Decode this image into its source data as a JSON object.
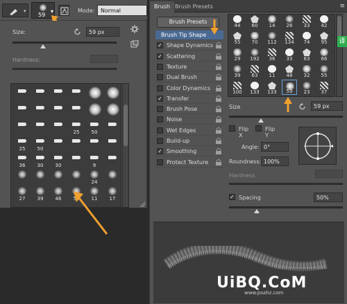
{
  "options_bar": {
    "brush_size": "59",
    "mode_label": "Mode:",
    "mode_value": "Normal"
  },
  "brush_picker": {
    "size_label": "Size:",
    "size_value": "59 px",
    "hardness_label": "Hardness:",
    "grid": [
      {
        "n": ""
      },
      {
        "n": ""
      },
      {
        "n": ""
      },
      {
        "n": ""
      },
      {
        "n": ""
      },
      {
        "n": ""
      },
      {
        "n": ""
      },
      {
        "n": ""
      },
      {
        "n": ""
      },
      {
        "n": ""
      },
      {
        "n": ""
      },
      {
        "n": ""
      },
      {
        "n": ""
      },
      {
        "n": ""
      },
      {
        "n": ""
      },
      {
        "n": "25"
      },
      {
        "n": "50"
      },
      {
        "n": ""
      },
      {
        "n": "25"
      },
      {
        "n": "50"
      },
      {
        "n": ""
      },
      {
        "n": ""
      },
      {
        "n": ""
      },
      {
        "n": ""
      },
      {
        "n": "36"
      },
      {
        "n": "30"
      },
      {
        "n": "30"
      },
      {
        "n": ""
      },
      {
        "n": "9"
      },
      {
        "n": ""
      },
      {
        "n": ""
      },
      {
        "n": ""
      },
      {
        "n": ""
      },
      {
        "n": ""
      },
      {
        "n": "24"
      },
      {
        "n": ""
      },
      {
        "n": "27"
      },
      {
        "n": "39"
      },
      {
        "n": "46"
      },
      {
        "n": "59"
      },
      {
        "n": "11"
      },
      {
        "n": "17"
      }
    ]
  },
  "brush_panel": {
    "tabs": [
      {
        "label": "Brush"
      },
      {
        "label": "Brush Presets"
      }
    ],
    "presets_button": "Brush Presets",
    "options": [
      {
        "label": "Brush Tip Shape",
        "checked": null
      },
      {
        "label": "Shape Dynamics",
        "checked": true
      },
      {
        "label": "Scattering",
        "checked": true
      },
      {
        "label": "Texture",
        "checked": false
      },
      {
        "label": "Dual Brush",
        "checked": false
      },
      {
        "label": "Color Dynamics",
        "checked": false
      },
      {
        "label": "Transfer",
        "checked": true
      },
      {
        "label": "Brush Pose",
        "checked": false
      },
      {
        "label": "Noise",
        "checked": false
      },
      {
        "label": "Wet Edges",
        "checked": false
      },
      {
        "label": "Build-up",
        "checked": false
      },
      {
        "label": "Smoothing",
        "checked": true
      },
      {
        "label": "Protect Texture",
        "checked": false
      }
    ],
    "tip_grid": [
      {
        "n": "44"
      },
      {
        "n": "60"
      },
      {
        "n": "14"
      },
      {
        "n": "26"
      },
      {
        "n": "33"
      },
      {
        "n": "42"
      },
      {
        "n": "55"
      },
      {
        "n": "70"
      },
      {
        "n": "112"
      },
      {
        "n": "134"
      },
      {
        "n": "74"
      },
      {
        "n": "95"
      },
      {
        "n": "29"
      },
      {
        "n": "192"
      },
      {
        "n": "36"
      },
      {
        "n": "33"
      },
      {
        "n": "63"
      },
      {
        "n": "66"
      },
      {
        "n": "39"
      },
      {
        "n": "63"
      },
      {
        "n": "11"
      },
      {
        "n": "48"
      },
      {
        "n": "32"
      },
      {
        "n": "55"
      },
      {
        "n": "100"
      },
      {
        "n": "133"
      },
      {
        "n": "133"
      },
      {
        "n": "59"
      },
      {
        "n": "23"
      },
      {
        "n": "37"
      }
    ],
    "size_label": "Size",
    "size_value": "59 px",
    "flip_x": "Flip X",
    "flip_y": "Flip Y",
    "angle_label": "Angle:",
    "angle_value": "0°",
    "roundness_label": "Roundness:",
    "roundness_value": "100%",
    "hardness_label": "Hardness",
    "spacing_label": "Spacing",
    "spacing_value": "50%"
  },
  "badge": "译",
  "watermark": "UiBQ.CoM",
  "watermark_sub": "www.psahz.com",
  "colors": {
    "panel": "#535353",
    "selection": "#4a6a93",
    "arrow": "#f0a030"
  }
}
